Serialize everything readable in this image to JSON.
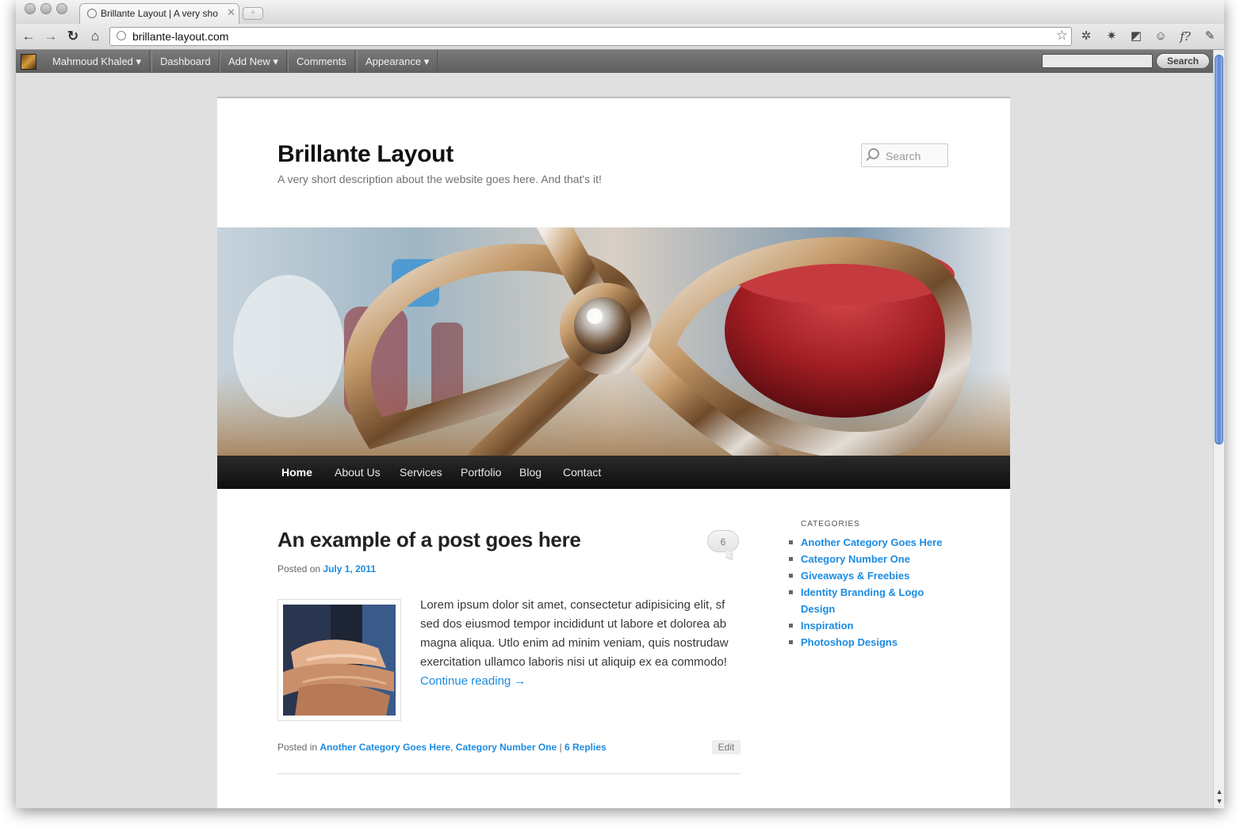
{
  "browser": {
    "tab_title": "Brillante Layout | A very sho",
    "tab_close": "✕",
    "url": "brillante-layout.com",
    "new_tab": "+"
  },
  "admin_bar": {
    "items": [
      "Mahmoud Khaled ▾",
      "Dashboard",
      "Add New ▾",
      "Comments",
      "Appearance ▾"
    ],
    "search_button": "Search"
  },
  "site": {
    "title": "Brillante Layout",
    "description": "A very short description about the website goes here. And that's it!",
    "search_placeholder": "Search"
  },
  "nav": {
    "items": [
      "Home",
      "About Us",
      "Services",
      "Portfolio",
      "Blog",
      "Contact"
    ],
    "active": "Home"
  },
  "post": {
    "title": "An example of a post goes here",
    "comment_count": "6",
    "posted_on_label": "Posted on",
    "date": "July 1, 2011",
    "excerpt": "Lorem ipsum dolor sit amet, consectetur adipisicing elit, sf sed dos eiusmod tempor incididunt ut labore et dolorea ab magna aliqua. Utlo enim ad minim veniam, quis nostrudaw exercitation ullamco laboris nisi ut aliquip ex ea commodo!",
    "continue_reading": "Continue reading →",
    "posted_in_label": "Posted in",
    "category_1": "Another Category Goes Here",
    "category_sep": ",",
    "category_2": "Category Number One",
    "pipe": "|",
    "replies": "6 Replies",
    "edit_label": "Edit"
  },
  "sidebar": {
    "heading": "CATEGORIES",
    "categories": [
      "Another Category Goes Here",
      "Category Number One",
      "Giveaways & Freebies",
      "Identity Branding & Logo Design",
      "Inspiration",
      "Photoshop Designs"
    ]
  },
  "colors": {
    "link": "#1b8be0",
    "nav_bg": "#1a1a1a",
    "scroll_thumb": "#5d88d4"
  }
}
